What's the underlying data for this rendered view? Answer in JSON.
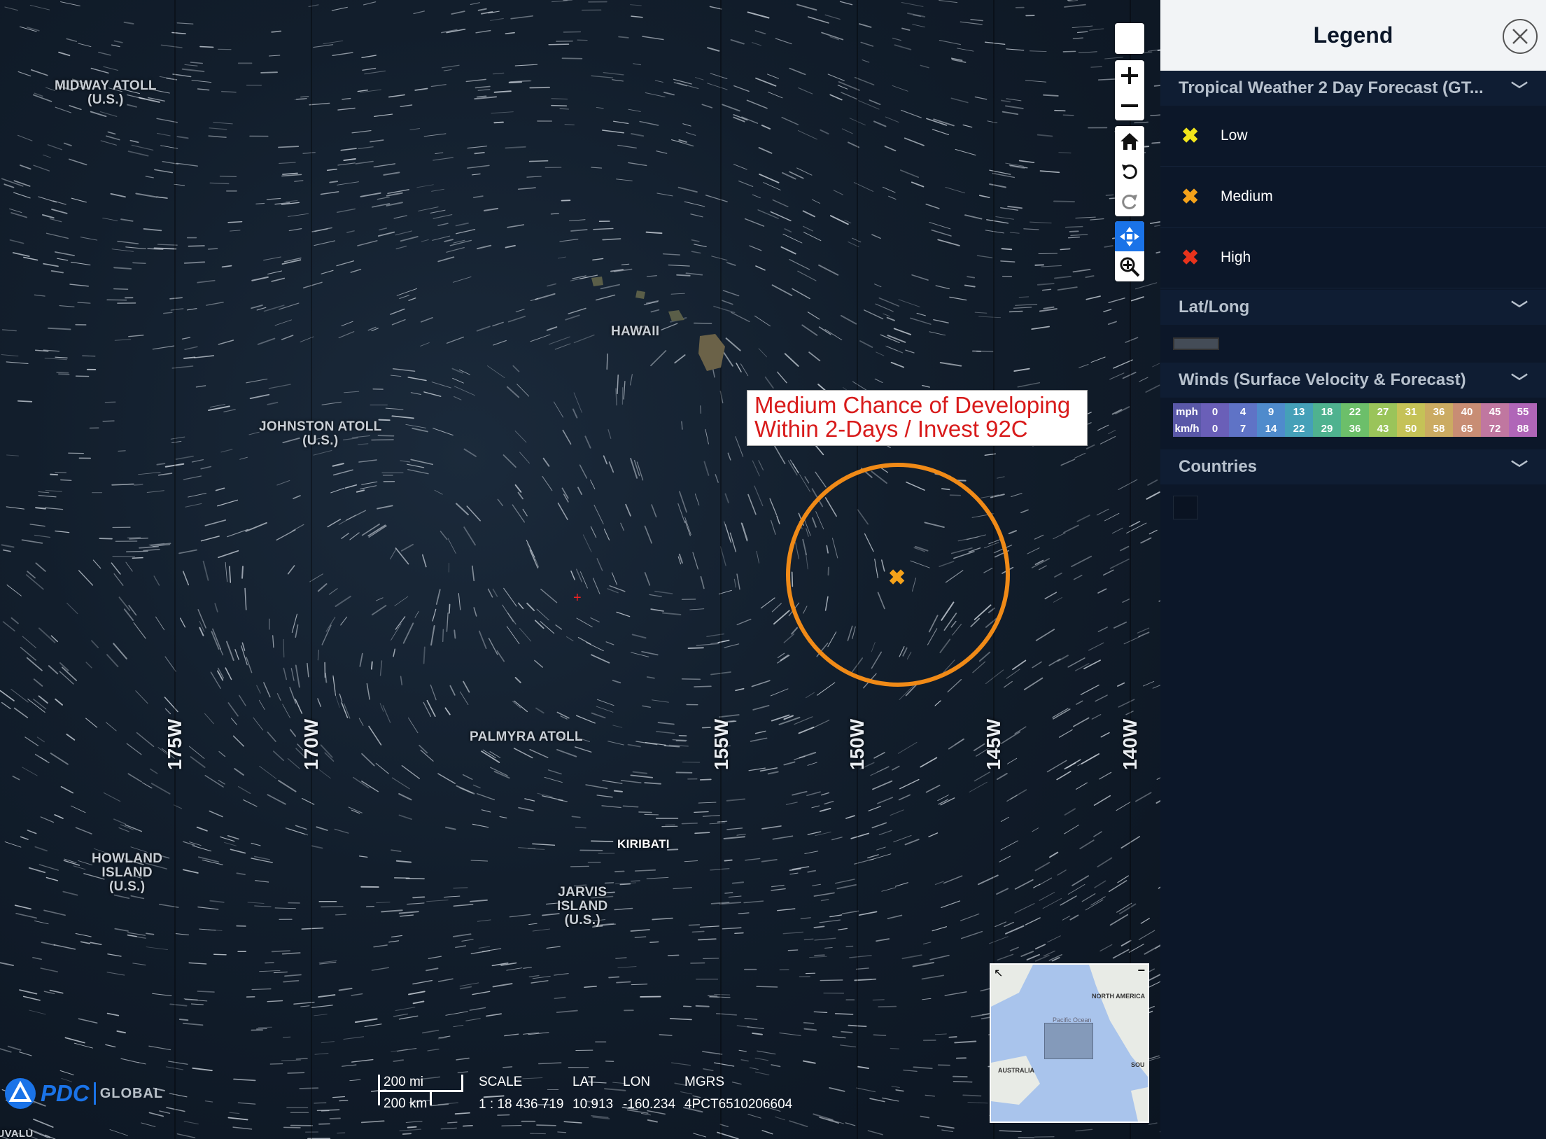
{
  "map": {
    "places": [
      {
        "id": "midway",
        "label": "MIDWAY ATOLL\n(U.S.)"
      },
      {
        "id": "hawaii",
        "label": "HAWAII"
      },
      {
        "id": "johnston",
        "label": "JOHNSTON ATOLL\n(U.S.)"
      },
      {
        "id": "palmyra",
        "label": "PALMYRA ATOLL"
      },
      {
        "id": "howland",
        "label": "HOWLAND\nISLAND\n(U.S.)"
      },
      {
        "id": "jarvis",
        "label": "JARVIS\nISLAND\n(U.S.)"
      },
      {
        "id": "kiribati",
        "label": "KIRIBATI"
      },
      {
        "id": "tuvalu",
        "label": "TUVALU"
      }
    ],
    "longitudes": [
      "175W",
      "170W",
      "155W",
      "150W",
      "145W",
      "140W"
    ],
    "callout": {
      "line1": "Medium Chance of Developing",
      "line2": "Within 2-Days / Invest 92C"
    },
    "highlight_color": "#f08a17",
    "marker_color": "#f5a21a",
    "minimap": {
      "labels": [
        "NORTH AMERICA",
        "Pacific Ocean",
        "AUSTRALIA",
        "SOU"
      ]
    },
    "scalebar": {
      "miles": "200 mi",
      "km": "200 km"
    },
    "readout": {
      "scale_label": "SCALE",
      "scale_value": "1 : 18 436 719",
      "lat_label": "LAT",
      "lat_value": "10.913",
      "lon_label": "LON",
      "lon_value": "-160.234",
      "mgrs_label": "MGRS",
      "mgrs_value": "4PCT6510206604"
    },
    "logo": {
      "brand": "PDC",
      "suffix": "GLOBAL"
    }
  },
  "controls": [
    "blank-button",
    "zoom-in",
    "zoom-out",
    "home",
    "rotate-left",
    "rotate-right",
    "pan",
    "zoom-tool"
  ],
  "legend": {
    "title": "Legend",
    "sections": {
      "tropical": {
        "title": "Tropical Weather 2 Day Forecast (GT...",
        "items": [
          {
            "label": "Low",
            "color": "#f2e51b"
          },
          {
            "label": "Medium",
            "color": "#f5a21a"
          },
          {
            "label": "High",
            "color": "#e8331c"
          }
        ]
      },
      "latlong": {
        "title": "Lat/Long"
      },
      "winds": {
        "title": "Winds (Surface Velocity & Forecast)",
        "mph_label": "mph",
        "kmh_label": "km/h",
        "mph": [
          "0",
          "4",
          "9",
          "13",
          "18",
          "22",
          "27",
          "31",
          "36",
          "40",
          "45",
          "55"
        ],
        "kmh": [
          "0",
          "7",
          "14",
          "22",
          "29",
          "36",
          "43",
          "50",
          "58",
          "65",
          "72",
          "88"
        ],
        "colors": [
          "#6a5fb8",
          "#5f73c6",
          "#4f8bcc",
          "#45a0b8",
          "#4fb28f",
          "#6cbf6a",
          "#9ac45a",
          "#c5c257",
          "#cbab62",
          "#c88d74",
          "#c077a0",
          "#b066b8"
        ]
      },
      "countries": {
        "title": "Countries"
      }
    }
  }
}
